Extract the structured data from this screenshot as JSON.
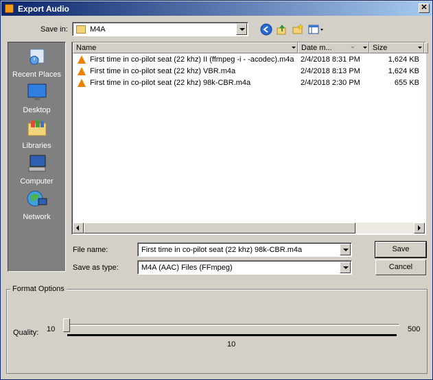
{
  "window": {
    "title": "Export Audio",
    "close_glyph": "✕"
  },
  "save_in": {
    "label": "Save in:",
    "value": "M4A"
  },
  "toolbar": {
    "icons": [
      "back-icon",
      "up-folder-icon",
      "new-folder-icon",
      "view-menu-icon"
    ]
  },
  "places": [
    {
      "label": "Recent Places",
      "icon": "recent-places-icon"
    },
    {
      "label": "Desktop",
      "icon": "desktop-icon"
    },
    {
      "label": "Libraries",
      "icon": "libraries-icon"
    },
    {
      "label": "Computer",
      "icon": "computer-icon"
    },
    {
      "label": "Network",
      "icon": "network-icon"
    }
  ],
  "columns": {
    "name": "Name",
    "date": "Date m...",
    "size": "Size"
  },
  "files": [
    {
      "name": "First time in co-pilot seat (22 khz) II (ffmpeg -i - -acodec).m4a",
      "date": "2/4/2018 8:31 PM",
      "size": "1,624 KB"
    },
    {
      "name": "First time in co-pilot seat (22 khz) VBR.m4a",
      "date": "2/4/2018 8:13 PM",
      "size": "1,624 KB"
    },
    {
      "name": "First time in co-pilot seat (22 khz) 98k-CBR.m4a",
      "date": "2/4/2018 2:30 PM",
      "size": "655 KB"
    }
  ],
  "file_name": {
    "label": "File name:",
    "value": "First time in co-pilot seat (22 khz) 98k-CBR.m4a"
  },
  "save_type": {
    "label": "Save as type:",
    "value": "M4A (AAC) Files (FFmpeg)"
  },
  "buttons": {
    "save": "Save",
    "cancel": "Cancel"
  },
  "format_options": {
    "title": "Format Options",
    "quality_label": "Quality:",
    "min": "10",
    "max": "500",
    "value": "10",
    "slider_position": 0.0
  }
}
